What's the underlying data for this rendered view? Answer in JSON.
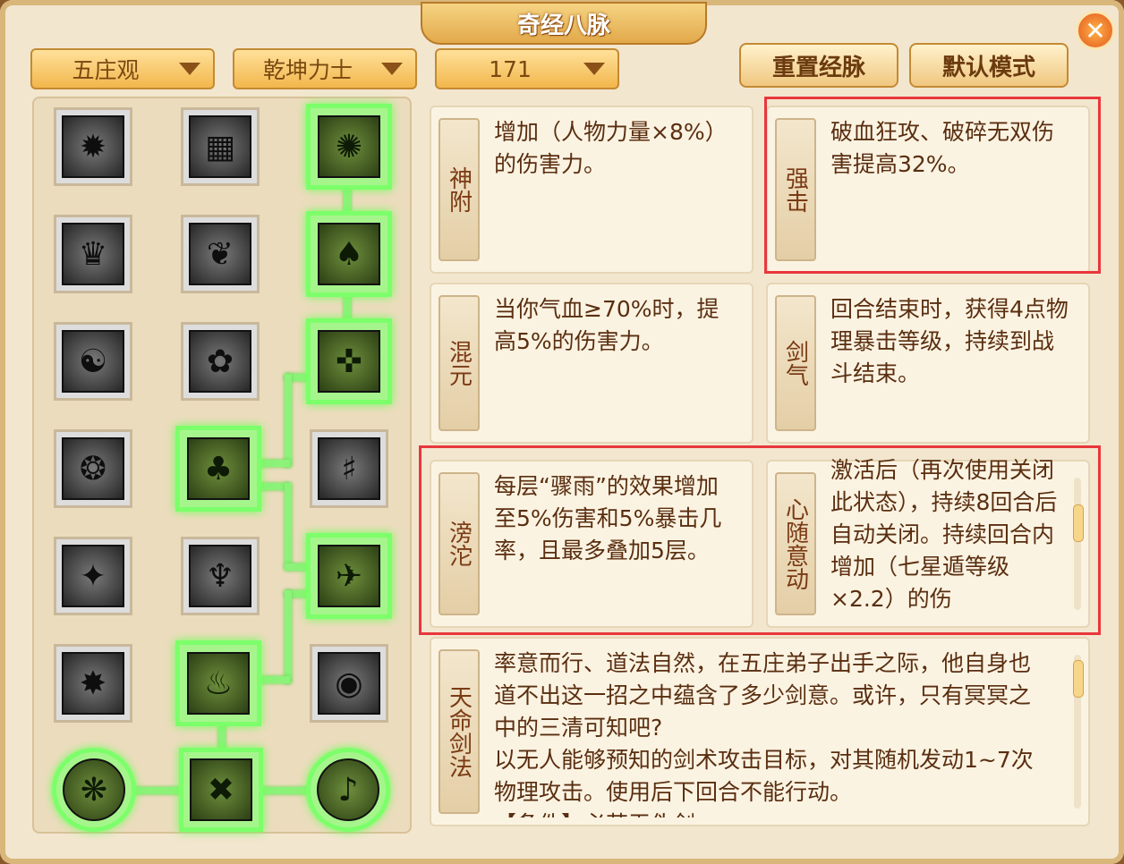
{
  "window": {
    "title": "奇经八脉",
    "close_label": "✕"
  },
  "dropdowns": [
    {
      "value": "五庄观"
    },
    {
      "value": "乾坤力士"
    },
    {
      "value": "171"
    }
  ],
  "buttons": {
    "reset": "重置经脉",
    "default_mode": "默认模式"
  },
  "tree_icons": [
    "✹",
    "▦",
    "✺",
    "♛",
    "❦",
    "♠",
    "☯",
    "✿",
    "✜",
    "❂",
    "♣",
    "♯",
    "✦",
    "♆",
    "✈",
    "✸",
    "♨",
    "◉",
    "❋",
    "✖",
    "♪"
  ],
  "cards": [
    {
      "name": "神附",
      "desc": "增加（人物力量×8%）的伤害力。"
    },
    {
      "name": "强击",
      "desc": "破血狂攻、破碎无双伤害提高32%。"
    },
    {
      "name": "混元",
      "desc": "当你气血≥70%时，提高5%的伤害力。"
    },
    {
      "name": "剑气",
      "desc": "回合结束时，获得4点物理暴击等级，持续到战斗结束。"
    },
    {
      "name": "滂沱",
      "desc": "每层“骤雨”的效果增加至5%伤害和5%暴击几率，且最多叠加5层。"
    },
    {
      "name": "心随意动",
      "desc": "激活后（再次使用关闭此状态），持续8回合后自动关闭。持续回合内增加（七星遁等级×2.2）的伤"
    },
    {
      "name": "天命剑法",
      "desc": "率意而行、道法自然，在五庄弟子出手之际，他自身也道不出这一招之中蕴含了多少剑意。或许，只有冥冥之中的三清可知吧?\n以无人能够预知的剑术攻击目标，对其随机发动1~7次物理攻击。使用后下回合不能行动。\n【条件】必若无伪剑"
    }
  ]
}
